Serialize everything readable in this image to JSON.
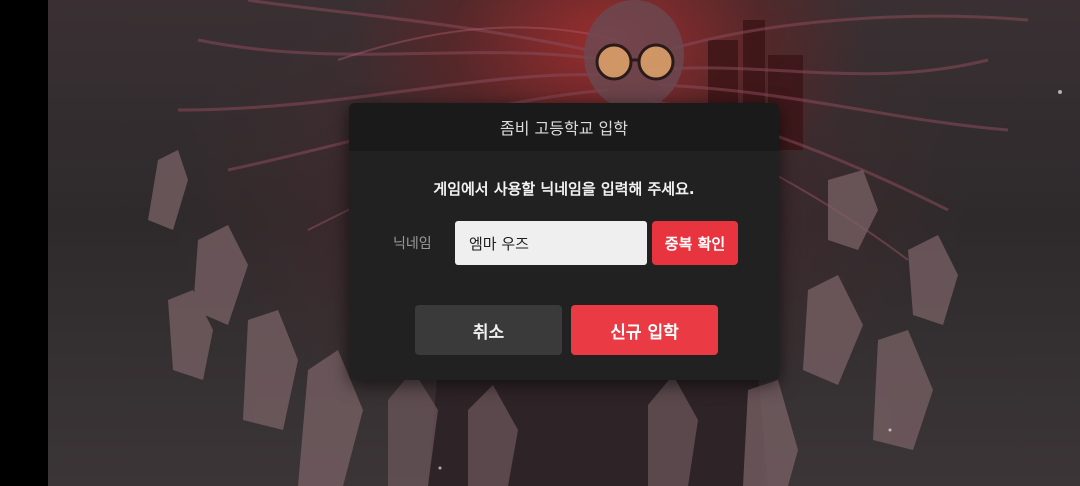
{
  "dialog": {
    "title": "좀비 고등학교 입학",
    "message": "게임에서 사용할 닉네임을 입력해 주세요.",
    "nickname_label": "닉네임",
    "nickname_value": "엠마 우즈",
    "duplicate_check_label": "중복 확인",
    "cancel_label": "취소",
    "enroll_label": "신규 입학"
  },
  "colors": {
    "accent": "#ea3a44",
    "dialog_bg": "#212121",
    "header_bg": "#1a1a1a",
    "cancel_bg": "#3a3a3a"
  }
}
